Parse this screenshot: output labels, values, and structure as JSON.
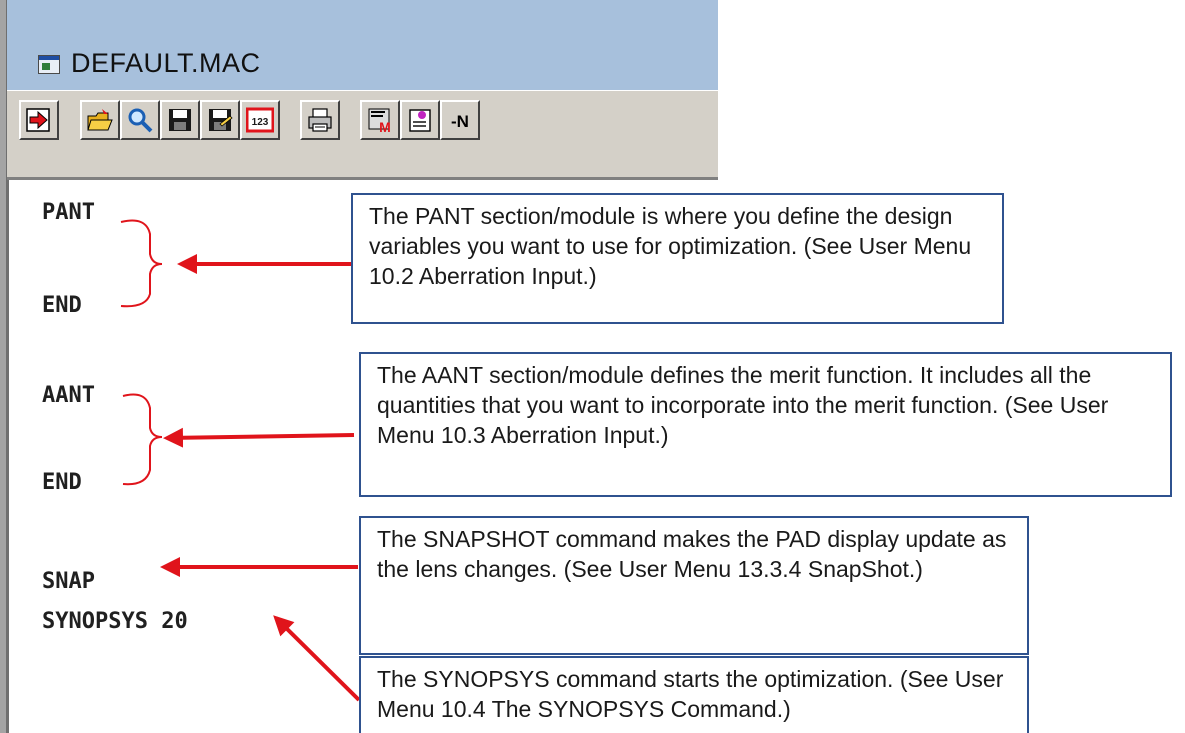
{
  "window": {
    "title": "DEFAULT.MAC"
  },
  "toolbar": {
    "buttons": [
      {
        "name": "exit-icon"
      },
      {
        "name": "open-folder-icon"
      },
      {
        "name": "find-icon"
      },
      {
        "name": "save-icon"
      },
      {
        "name": "save-as-icon"
      },
      {
        "name": "line-numbers-icon",
        "label": "123"
      },
      {
        "name": "print-icon"
      },
      {
        "name": "macro-icon"
      },
      {
        "name": "edit-note-icon"
      },
      {
        "name": "minus-n-icon",
        "label": "-N"
      }
    ]
  },
  "editor": {
    "lines": [
      "PANT",
      "END",
      "AANT",
      "END",
      "SNAP",
      "SYNOPSYS 20"
    ]
  },
  "callouts": {
    "pant": "The PANT section/module is where you define the design variables you want to use for optimization. (See User Menu 10.2 Aberration Input.)",
    "aant": "The AANT section/module defines the merit function.  It includes all the quantities that you want to incorporate into the merit function.  (See User Menu 10.3 Aberration Input.)",
    "snap": "The SNAPSHOT command makes the PAD display update as the lens changes. (See User Menu 13.3.4 SnapShot.)",
    "synopsys": "The SYNOPSYS command starts the optimization. (See User Menu 10.4 The SYNOPSYS Command.)"
  },
  "colors": {
    "titlebar": "#a7c0dc",
    "toolbar": "#d4d0c8",
    "callout_border": "#2f528f",
    "arrow": "#e0141b"
  }
}
